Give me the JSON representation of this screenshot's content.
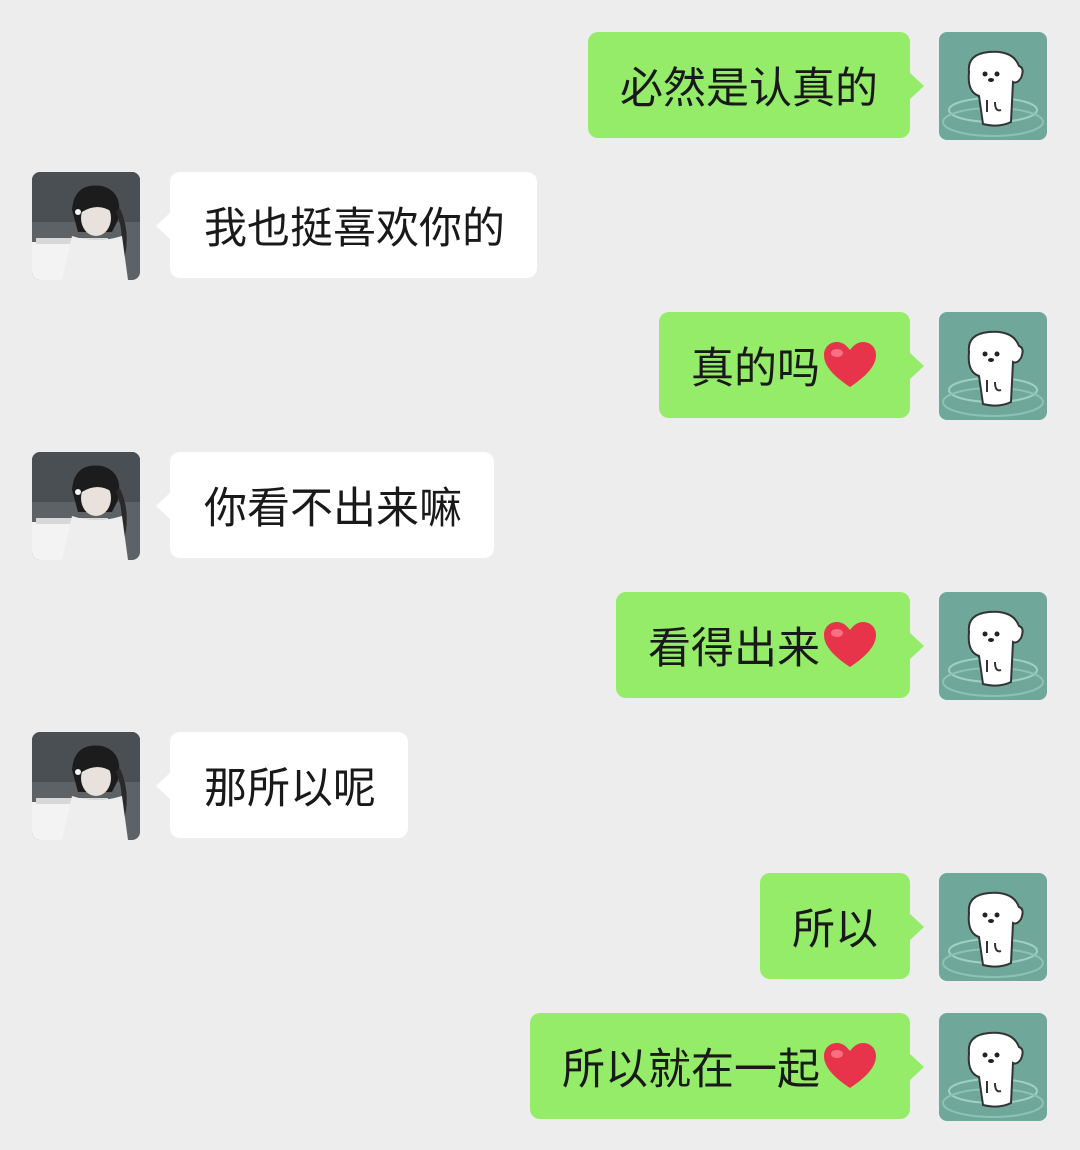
{
  "colors": {
    "background": "#ededed",
    "my_bubble": "#95ec69",
    "their_bubble": "#ffffff",
    "text": "#191919",
    "heart": "#e8344a"
  },
  "avatars": {
    "me": "dog-sticker-avatar",
    "them": "girl-with-headphones-avatar"
  },
  "messages": [
    {
      "sender": "me",
      "text": "必然是认真的",
      "heart": false
    },
    {
      "sender": "them",
      "text": "我也挺喜欢你的",
      "heart": false
    },
    {
      "sender": "me",
      "text": "真的吗",
      "heart": true
    },
    {
      "sender": "them",
      "text": "你看不出来嘛",
      "heart": false
    },
    {
      "sender": "me",
      "text": "看得出来",
      "heart": true
    },
    {
      "sender": "them",
      "text": "那所以呢",
      "heart": false
    },
    {
      "sender": "me",
      "text": "所以",
      "heart": false
    },
    {
      "sender": "me",
      "text": "所以就在一起",
      "heart": true
    }
  ]
}
